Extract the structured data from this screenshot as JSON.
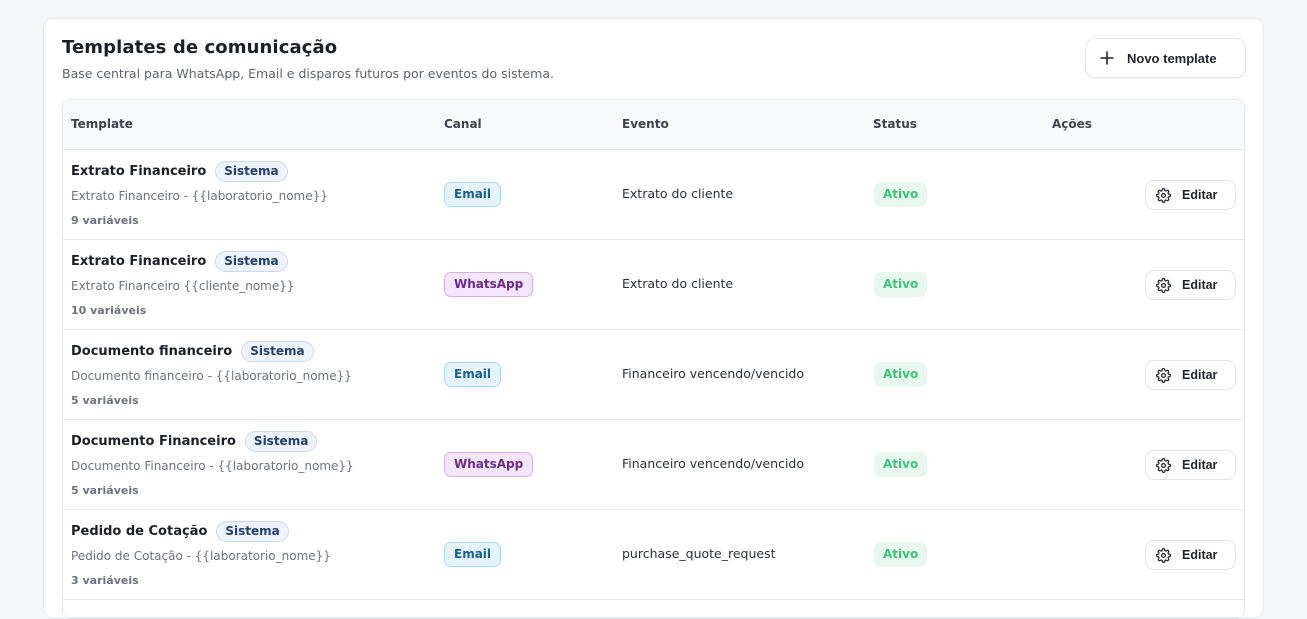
{
  "header": {
    "title": "Templates de comunicação",
    "subtitle": "Base central para WhatsApp, Email e disparos futuros por eventos do sistema.",
    "new_button_label": "Novo template"
  },
  "table": {
    "columns": {
      "template": "Template",
      "channel": "Canal",
      "event": "Evento",
      "status": "Status",
      "actions": "Ações"
    },
    "rows": [
      {
        "name": "Extrato Financeiro",
        "badge": "Sistema",
        "subject": "Extrato Financeiro - {{laboratorio_nome}}",
        "variables": "9 variáveis",
        "channel": "Email",
        "event": "Extrato do cliente",
        "status": "Ativo",
        "action": "Editar"
      },
      {
        "name": "Extrato Financeiro",
        "badge": "Sistema",
        "subject": "Extrato Financeiro {{cliente_nome}}",
        "variables": "10 variáveis",
        "channel": "WhatsApp",
        "event": "Extrato do cliente",
        "status": "Ativo",
        "action": "Editar"
      },
      {
        "name": "Documento financeiro",
        "badge": "Sistema",
        "subject": "Documento financeiro - {{laboratorio_nome}}",
        "variables": "5 variáveis",
        "channel": "Email",
        "event": "Financeiro vencendo/vencido",
        "status": "Ativo",
        "action": "Editar"
      },
      {
        "name": "Documento Financeiro",
        "badge": "Sistema",
        "subject": "Documento Financeiro - {{laboratorio_nome}}",
        "variables": "5 variáveis",
        "channel": "WhatsApp",
        "event": "Financeiro vencendo/vencido",
        "status": "Ativo",
        "action": "Editar"
      },
      {
        "name": "Pedido de Cotação",
        "badge": "Sistema",
        "subject": "Pedido de Cotação - {{laboratorio_nome}}",
        "variables": "3 variáveis",
        "channel": "Email",
        "event": "purchase_quote_request",
        "status": "Ativo",
        "action": "Editar"
      }
    ]
  },
  "icons": {
    "new_button": "plus-icon",
    "edit_button": "gear-icon"
  },
  "colors": {
    "status_active": "#3fc27a",
    "email_badge": "#1c5f8e",
    "whatsapp_badge": "#6b2b8a",
    "system_badge": "#23406e"
  }
}
